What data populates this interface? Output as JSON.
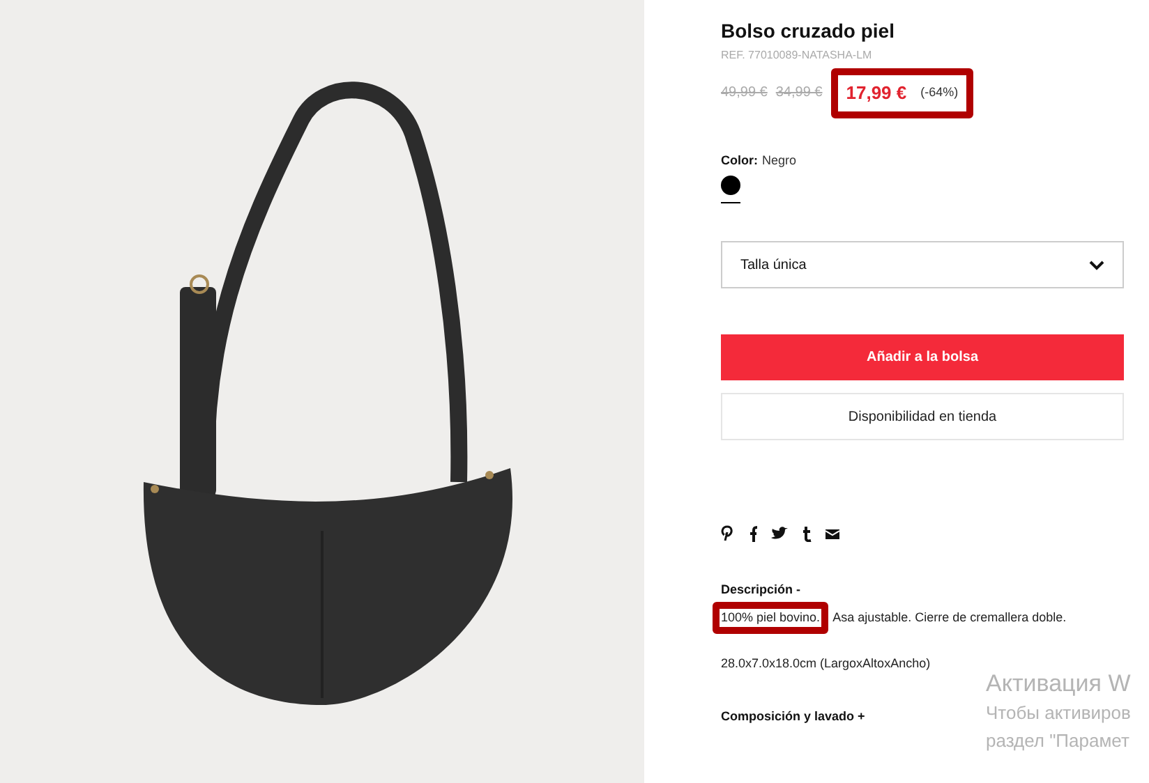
{
  "product": {
    "title": "Bolso cruzado piel",
    "ref": "REF. 77010089-NATASHA-LM",
    "old_prices": [
      "49,99 €",
      "34,99 €"
    ],
    "price": "17,99 €",
    "discount": "(-64%)",
    "price_highlighted": true,
    "color_label": "Color:",
    "color_name": "Negro",
    "swatches": [
      {
        "color": "#000000",
        "selected": true
      }
    ],
    "size_select": {
      "value": "Talla única"
    },
    "add_button": "Añadir a la bolsa",
    "store_button": "Disponibilidad en tienda",
    "description": {
      "heading": "Descripción -",
      "highlighted_text": "100% piel bovino.",
      "text": "Asa ajustable. Cierre de cremallera doble.",
      "dimensions": "28.0x7.0x18.0cm (LargoxAltoxAncho)"
    },
    "composition": "Composición y lavado +"
  },
  "os_notice": {
    "title": "Активация W",
    "lines": [
      "Чтобы активиров",
      "раздел \"Парамет"
    ]
  }
}
